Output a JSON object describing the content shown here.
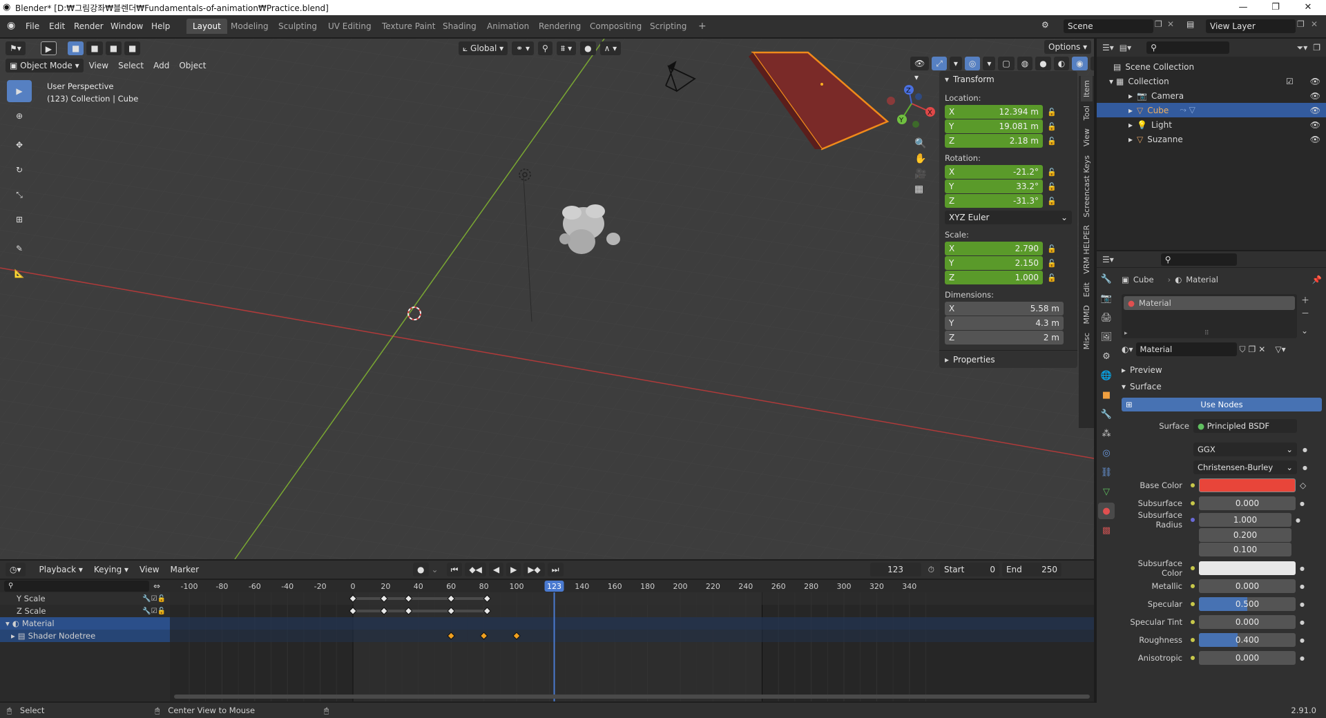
{
  "window": {
    "title": "Blender* [D:₩그림강좌₩블렌더₩Fundamentals-of-animation₩Practice.blend]"
  },
  "menus": [
    "File",
    "Edit",
    "Render",
    "Window",
    "Help"
  ],
  "workspaces": [
    "Layout",
    "Modeling",
    "Sculpting",
    "UV Editing",
    "Texture Paint",
    "Shading",
    "Animation",
    "Rendering",
    "Compositing",
    "Scripting"
  ],
  "scene": {
    "name": "Scene",
    "view_layer": "View Layer"
  },
  "viewport": {
    "mode": "Object Mode",
    "menus": [
      "View",
      "Select",
      "Add",
      "Object"
    ],
    "orientation": "Global",
    "options": "Options",
    "overlay_line1": "User Perspective",
    "overlay_line2": "(123) Collection | Cube"
  },
  "npanel": {
    "transform": "Transform",
    "location_label": "Location:",
    "location": [
      {
        "axis": "X",
        "value": "12.394 m"
      },
      {
        "axis": "Y",
        "value": "19.081 m"
      },
      {
        "axis": "Z",
        "value": "2.18 m"
      }
    ],
    "rotation_label": "Rotation:",
    "rotation": [
      {
        "axis": "X",
        "value": "-21.2°"
      },
      {
        "axis": "Y",
        "value": "33.2°"
      },
      {
        "axis": "Z",
        "value": "-31.3°"
      }
    ],
    "rotation_mode": "XYZ Euler",
    "scale_label": "Scale:",
    "scale": [
      {
        "axis": "X",
        "value": "2.790"
      },
      {
        "axis": "Y",
        "value": "2.150"
      },
      {
        "axis": "Z",
        "value": "1.000"
      }
    ],
    "dimensions_label": "Dimensions:",
    "dimensions": [
      {
        "axis": "X",
        "value": "5.58 m"
      },
      {
        "axis": "Y",
        "value": "4.3 m"
      },
      {
        "axis": "Z",
        "value": "2 m"
      }
    ],
    "properties": "Properties",
    "tabs": [
      "Item",
      "Tool",
      "View",
      "Screencast Keys",
      "VRM HELPER",
      "Edit",
      "MMD",
      "Misc"
    ]
  },
  "outliner": {
    "root": "Scene Collection",
    "collection": "Collection",
    "items": [
      {
        "name": "Camera",
        "color": "#e0a060"
      },
      {
        "name": "Cube",
        "color": "#e0a060"
      },
      {
        "name": "Light",
        "color": "#e0a060"
      },
      {
        "name": "Suzanne",
        "color": "#e0a060"
      }
    ]
  },
  "properties": {
    "breadcrumb_object": "Cube",
    "breadcrumb_material": "Material",
    "slot": "Material",
    "material_name": "Material",
    "preview": "Preview",
    "surface_section": "Surface",
    "use_nodes": "Use Nodes",
    "surface_label": "Surface",
    "surface_value": "Principled BSDF",
    "distribution": "GGX",
    "subsurface_method": "Christensen-Burley",
    "base_color_label": "Base Color",
    "base_color": "#e8453a",
    "subsurface_label": "Subsurface",
    "subsurface": "0.000",
    "subsurface_radius_label": "Subsurface Radius",
    "subsurface_radius": [
      "1.000",
      "0.200",
      "0.100"
    ],
    "subsurface_color_label": "Subsurface Color",
    "subsurface_color": "#e8e8e8",
    "metallic_label": "Metallic",
    "metallic": "0.000",
    "specular_label": "Specular",
    "specular": "0.500",
    "specular_fill": 0.5,
    "specular_tint_label": "Specular Tint",
    "specular_tint": "0.000",
    "roughness_label": "Roughness",
    "roughness": "0.400",
    "roughness_fill": 0.4,
    "anisotropic_label": "Anisotropic",
    "anisotropic": "0.000"
  },
  "timeline": {
    "menus": [
      "Playback",
      "Keying",
      "View",
      "Marker"
    ],
    "current_frame": "123",
    "start_label": "Start",
    "start": "0",
    "end_label": "End",
    "end": "250",
    "ruler": [
      "-100",
      "-80",
      "-60",
      "-40",
      "-20",
      "0",
      "20",
      "40",
      "60",
      "80",
      "100",
      "140",
      "160",
      "180",
      "200",
      "220",
      "240",
      "260",
      "280",
      "300",
      "320",
      "340"
    ],
    "channels": [
      "Y Scale",
      "Z Scale",
      "Material",
      "Shader Nodetree"
    ],
    "keyframes_scale": [
      0,
      19,
      34,
      60,
      82
    ],
    "keyframes_material": [
      60,
      80,
      100
    ]
  },
  "status": {
    "select": "Select",
    "center": "Center View to Mouse",
    "version": "2.91.0"
  }
}
